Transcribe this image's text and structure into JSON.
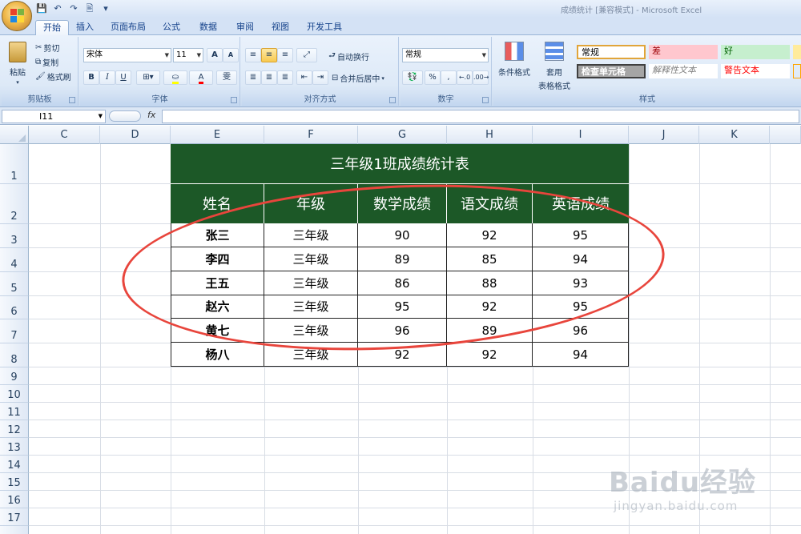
{
  "window": {
    "app_title": "成绩统计  [兼容模式] - Microsoft Excel"
  },
  "qat": [
    "💾",
    "↶",
    "↷",
    "🖹",
    "▾"
  ],
  "tabs": [
    {
      "label": "开始",
      "active": true
    },
    {
      "label": "插入"
    },
    {
      "label": "页面布局"
    },
    {
      "label": "公式"
    },
    {
      "label": "数据"
    },
    {
      "label": "审阅"
    },
    {
      "label": "视图"
    },
    {
      "label": "开发工具"
    }
  ],
  "ribbon": {
    "clipboard": {
      "label": "剪贴板",
      "paste": "粘贴",
      "cut": "剪切",
      "copy": "复制",
      "format_painter": "格式刷"
    },
    "font": {
      "label": "字体",
      "font_name": "宋体",
      "font_size": "11",
      "bold": "B",
      "italic": "I",
      "underline": "U",
      "grow": "A",
      "shrink": "A",
      "phonetic": "雯"
    },
    "alignment": {
      "label": "对齐方式",
      "wrap_text": "自动换行",
      "merge_center": "合并后居中"
    },
    "number": {
      "label": "数字",
      "format": "常规",
      "percent": "%",
      "comma": ","
    },
    "styles": {
      "label": "样式",
      "conditional": "条件格式",
      "table_format_1": "套用",
      "table_format_2": "表格格式",
      "cells": [
        {
          "text": "常规",
          "bg": "#ffffff",
          "fg": "#000000"
        },
        {
          "text": "差",
          "bg": "#ffc7ce",
          "fg": "#9c0006"
        },
        {
          "text": "好",
          "bg": "#c6efce",
          "fg": "#006100"
        },
        {
          "text": "检查单元格",
          "bg": "#a5a5a5",
          "fg": "#ffffff"
        },
        {
          "text": "解释性文本",
          "bg": "#ffffff",
          "fg": "#7f7f7f"
        },
        {
          "text": "警告文本",
          "bg": "#ffffff",
          "fg": "#ff0000"
        }
      ]
    }
  },
  "formula_bar": {
    "cell_ref": "I11",
    "fx": "fx"
  },
  "columns": [
    "C",
    "D",
    "E",
    "F",
    "G",
    "H",
    "I",
    "J",
    "K"
  ],
  "rows": [
    "1",
    "2",
    "3",
    "4",
    "5",
    "6",
    "7",
    "8",
    "9",
    "10",
    "11",
    "12",
    "13",
    "14",
    "15",
    "16",
    "17"
  ],
  "table": {
    "title": "三年级1班成绩统计表",
    "headers": [
      "姓名",
      "年级",
      "数学成绩",
      "语文成绩",
      "英语成绩"
    ],
    "rows": [
      [
        "张三",
        "三年级",
        "90",
        "92",
        "95"
      ],
      [
        "李四",
        "三年级",
        "89",
        "85",
        "94"
      ],
      [
        "王五",
        "三年级",
        "86",
        "88",
        "93"
      ],
      [
        "赵六",
        "三年级",
        "95",
        "92",
        "95"
      ],
      [
        "黄七",
        "三年级",
        "96",
        "89",
        "96"
      ],
      [
        "杨八",
        "三年级",
        "92",
        "92",
        "94"
      ]
    ],
    "header_bg": "#1c5827"
  },
  "watermark": {
    "logo": "Baidu经验",
    "url": "jingyan.baidu.com"
  }
}
